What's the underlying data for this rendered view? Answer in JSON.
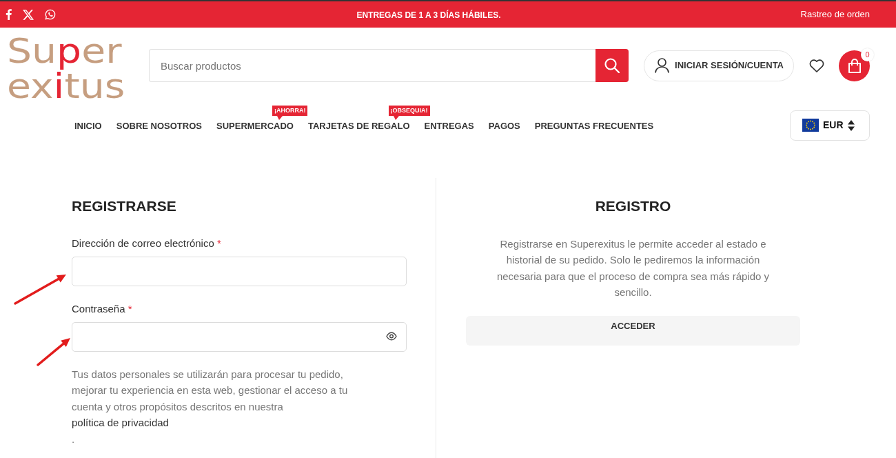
{
  "top_bar": {
    "social_links": [
      {
        "kind": "facebook"
      },
      {
        "kind": "x"
      },
      {
        "kind": "whatsapp"
      }
    ],
    "announcement": "ENTREGAS DE 1 A 3 DÍAS HÁBILES.",
    "order_tracking_link": "Rastreo de orden"
  },
  "header": {
    "logo": {
      "lines": [
        "Super",
        "exitus"
      ]
    },
    "search": {
      "placeholder": "Buscar productos"
    },
    "account_button": "INICIAR SESIÓN/CUENTA",
    "cart_count": "0"
  },
  "nav": {
    "items": [
      {
        "label": "INICIO"
      },
      {
        "label": "SOBRE NOSOTROS"
      },
      {
        "label": "SUPERMERCADO",
        "badge": "¡AHORRA!"
      },
      {
        "label": "TARJETAS DE REGALO",
        "badge": "¡OBSEQUIA!"
      },
      {
        "label": "ENTREGAS"
      },
      {
        "label": "PAGOS"
      },
      {
        "label": "PREGUNTAS FRECUENTES"
      }
    ],
    "currency": {
      "code": "EUR"
    }
  },
  "register_form": {
    "title": "REGISTRARSE",
    "fields": [
      {
        "kind": "email",
        "label": "Dirección de correo electrónico",
        "required_mark": "*",
        "arrow": true
      },
      {
        "kind": "password",
        "label": "Contraseña",
        "required_mark": "*",
        "arrow": true
      }
    ],
    "privacy_notice": {
      "text": "Tus datos personales se utilizarán para procesar tu pedido, mejorar tu experiencia en esta web, gestionar el acceso a tu cuenta y otros propósitos descritos en nuestra",
      "link": "política de privacidad",
      "end": "."
    }
  },
  "register_info": {
    "title": "REGISTRO",
    "text": "Registrarse en Superexitus le permite acceder al estado e historial de su pedido. Solo le pediremos la información necesaria para que el proceso de compra sea más rápido y sencillo.",
    "button": "ACCEDER"
  }
}
